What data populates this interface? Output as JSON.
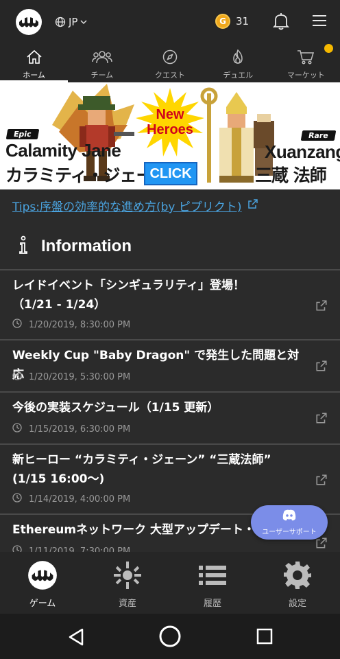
{
  "header": {
    "language": "JP",
    "coin_symbol": "G",
    "coin_count": "31"
  },
  "nav": {
    "items": [
      {
        "label": "ホーム",
        "icon": "home-icon",
        "active": true
      },
      {
        "label": "チーム",
        "icon": "team-icon"
      },
      {
        "label": "クエスト",
        "icon": "compass-icon"
      },
      {
        "label": "デュエル",
        "icon": "flame-icon"
      },
      {
        "label": "マーケット",
        "icon": "cart-icon",
        "badge": true
      }
    ]
  },
  "banner": {
    "left_rarity": "Epic",
    "left_name_en": "Calamity Jane",
    "left_name_jp": "カラミティ・ジェーン",
    "center_line1": "New",
    "center_line2": "Heroes",
    "click_label": "CLICK",
    "right_rarity": "Rare",
    "right_name_en": "Xuanzang",
    "right_name_jp": "三蔵 法師"
  },
  "tips": {
    "prefix": "Tips:",
    "text": "序盤の効率的な進め方(by ピプリクト)"
  },
  "info": {
    "title": "Information",
    "items": [
      {
        "line1": "レイドイベント「シンギュラリティ」登場！",
        "line2": "（1/21 - 1/24）",
        "date": "1/20/2019, 8:30:00 PM"
      },
      {
        "line1": "Weekly Cup \"Baby Dragon\" で発生した問題と対応",
        "line2": "",
        "date": "1/20/2019, 5:30:00 PM"
      },
      {
        "line1": "今後の実装スケジュール（1/15 更新）",
        "line2": "",
        "date": "1/15/2019, 6:30:00 PM"
      },
      {
        "line1": "新ヒーロー “カラミティ・ジェーン” “三蔵法師”",
        "line2": "(1/15 16:00〜)",
        "date": "1/14/2019, 4:00:00 PM"
      },
      {
        "line1": "Ethereumネットワーク 大型アップデート・",
        "line2": "",
        "date": "1/11/2019, 7:30:00 PM"
      }
    ]
  },
  "support": {
    "label": "ユーザーサポート"
  },
  "bottom_nav": {
    "items": [
      {
        "label": "ゲーム",
        "icon": "game-logo-icon",
        "active": true
      },
      {
        "label": "資産",
        "icon": "assets-icon"
      },
      {
        "label": "履歴",
        "icon": "list-icon"
      },
      {
        "label": "設定",
        "icon": "gear-icon"
      }
    ]
  }
}
